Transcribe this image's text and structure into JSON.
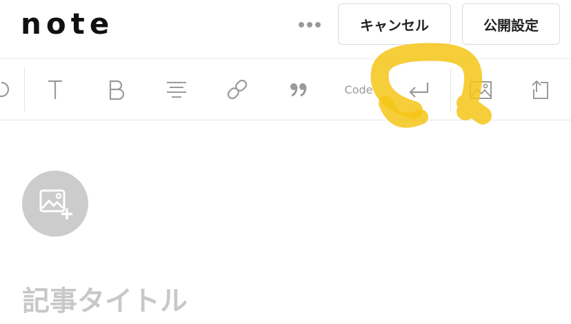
{
  "header": {
    "logo_text": "note",
    "more_icon": "ellipsis-icon",
    "cancel_label": "キャンセル",
    "publish_settings_label": "公開設定"
  },
  "toolbar": {
    "tools": [
      {
        "name": "undo",
        "icon": "undo-icon"
      },
      {
        "name": "heading",
        "icon": "text-heading-icon"
      },
      {
        "name": "bold",
        "icon": "bold-icon"
      },
      {
        "name": "align",
        "icon": "align-center-icon"
      },
      {
        "name": "link",
        "icon": "link-icon"
      },
      {
        "name": "quote",
        "icon": "quote-icon"
      },
      {
        "name": "code",
        "label": "Code"
      },
      {
        "name": "line-break",
        "icon": "return-icon"
      },
      {
        "name": "image",
        "icon": "image-icon"
      },
      {
        "name": "upload",
        "icon": "upload-icon"
      }
    ],
    "code_label": "Code"
  },
  "annotation": {
    "color": "#f5c518",
    "target": "line-break"
  },
  "editor": {
    "add_image_icon": "image-plus-icon",
    "title_placeholder": "記事タイトル"
  },
  "colors": {
    "icon_gray": "#9a9a9a",
    "placeholder_gray": "#c8c8c8",
    "circle_gray": "#cccccc",
    "highlight_yellow": "#f5c518"
  }
}
